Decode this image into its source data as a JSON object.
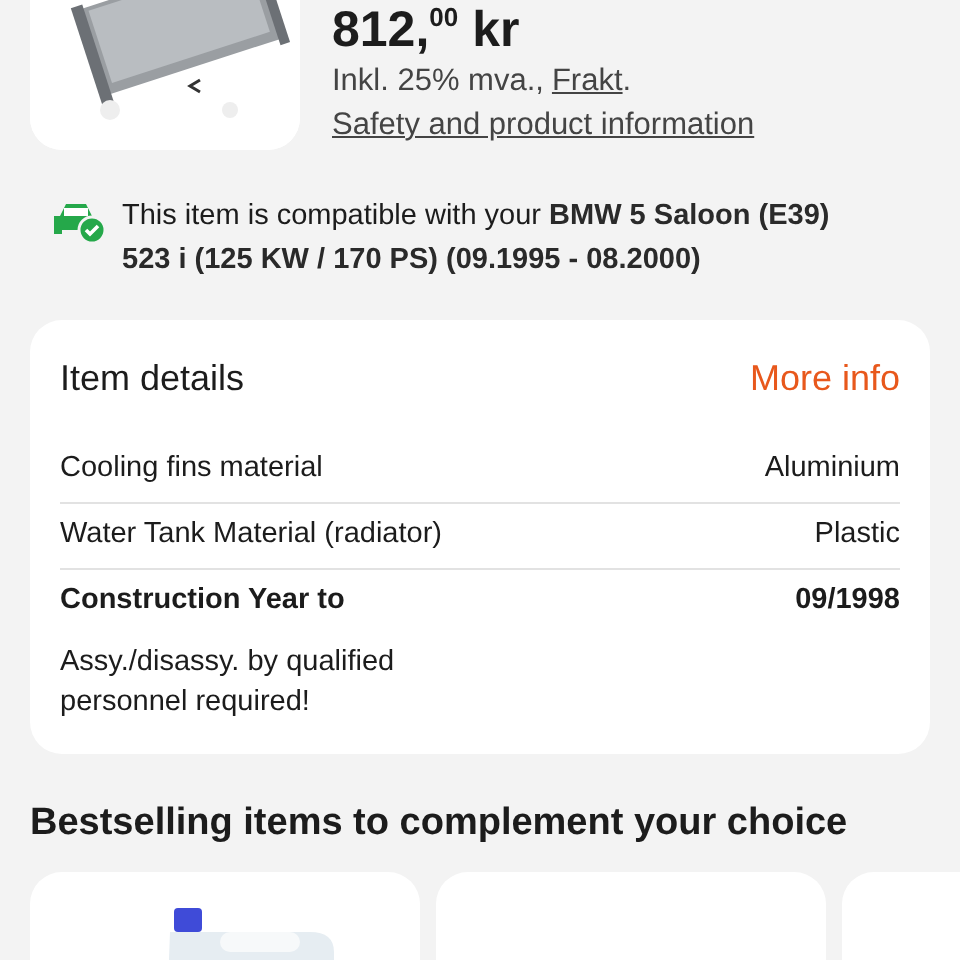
{
  "product": {
    "image": {
      "kind": "picture"
    },
    "price": "812,$^{00}$ kr",
    "tax_note": {
      "before": "Inkl. 25% mva.,",
      "link": "Frakt",
      "after": "."
    },
    "safety_link": "Safety and product information"
  },
  "compatibility": {
    "text": "This item is compatible with your **BMW 5 Saloon (E39) 523 i (125 KW / 170 PS) (09.1995 - 08.2000)**"
  },
  "item_details": {
    "title": "Item details",
    "more_link": "More info",
    "rows": [
      {
        "label": "Cooling fins material",
        "value": "Aluminium",
        "bold": false
      },
      {
        "label": "Water Tank Material (radiator)",
        "value": "Plastic",
        "bold": false
      },
      {
        "label": "Construction Year to",
        "value": "09/1998",
        "bold": true
      }
    ],
    "note": "Assy./disassy. by qualified personnel required!"
  },
  "bestselling": {
    "title": "Bestselling items to complement your choice",
    "cards": [
      {
        "kind": "picture"
      },
      {
        "kind": "blank"
      },
      {
        "kind": "blank"
      }
    ]
  }
}
